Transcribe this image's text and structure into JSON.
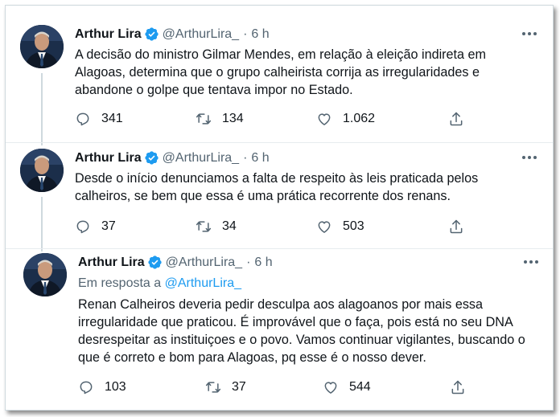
{
  "tweets": [
    {
      "name": "Arthur Lira",
      "handle": "@ArthurLira_",
      "time": "6 h",
      "text": "A decisão do ministro Gilmar Mendes, em relação à eleição indireta em Alagoas, determina que o grupo calheirista corrija as irregularidades e abandone o golpe que tentava impor no Estado.",
      "replies": "341",
      "retweets": "134",
      "likes": "1.062"
    },
    {
      "name": "Arthur Lira",
      "handle": "@ArthurLira_",
      "time": "6 h",
      "text": "Desde o início denunciamos a falta de respeito às leis praticada pelos calheiros, se bem que essa é uma prática recorrente dos renans.",
      "replies": "37",
      "retweets": "34",
      "likes": "503"
    },
    {
      "name": "Arthur Lira",
      "handle": "@ArthurLira_",
      "time": "6 h",
      "reply_prefix": "Em resposta a",
      "reply_handle": "@ArthurLira_",
      "text": "Renan Calheiros deveria pedir desculpa aos alagoanos por mais essa irregularidade que praticou. É improvável que o faça, pois está no seu DNA desrespeitar as instituiçoes e o povo. Vamos continuar vigilantes, buscando o que é correto e bom para Alagoas, pq esse é o nosso dever.",
      "replies": "103",
      "retweets": "37",
      "likes": "544"
    }
  ],
  "separator": "·",
  "icons": {
    "verified": "verified-badge-icon",
    "more": "more-options-icon",
    "reply": "reply-icon",
    "retweet": "retweet-icon",
    "like": "like-heart-icon",
    "share": "share-icon"
  },
  "colors": {
    "accent": "#1d9bf0",
    "secondary_text": "#536471",
    "primary_text": "#0f1419"
  }
}
